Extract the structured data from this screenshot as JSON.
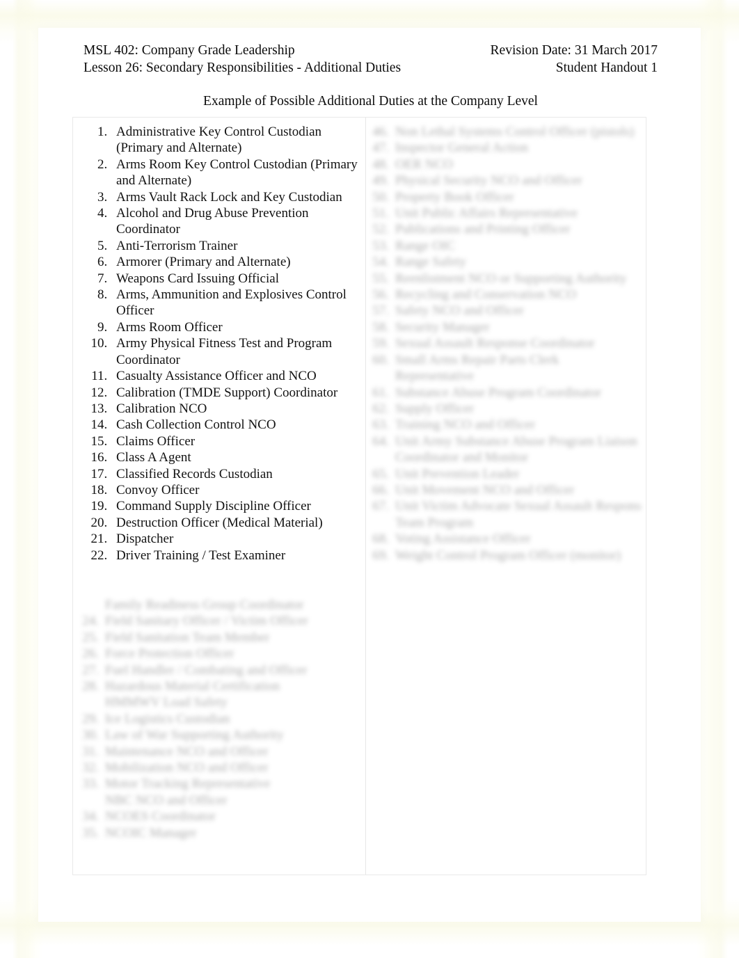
{
  "page": {
    "background_color": "#ffffff",
    "sheet_color": "#ffffff",
    "frame_tint": "#fbfbf0",
    "border_color": "#e9e9e9",
    "text_color": "#121212"
  },
  "header": {
    "course": "MSL 402: Company Grade Leadership",
    "revision": "Revision Date: 31 March 2017",
    "lesson": "Lesson 26: Secondary Responsibilities - Additional Duties",
    "handout": "Student Handout 1"
  },
  "title": "Example of Possible Additional Duties at the Company Level",
  "left_column": {
    "items": [
      "Administrative Key Control Custodian (Primary and Alternate)",
      "Arms Room Key Control Custodian (Primary and Alternate)",
      "Arms Vault Rack Lock and Key Custodian",
      "Alcohol and Drug Abuse Prevention Coordinator",
      "Anti-Terrorism Trainer",
      "Armorer (Primary and Alternate)",
      "Weapons Card Issuing Official",
      "Arms, Ammunition and Explosives Control Officer",
      "Arms Room Officer",
      "Army Physical Fitness Test and Program Coordinator",
      "Casualty Assistance Officer and NCO",
      "Calibration (TMDE Support) Coordinator",
      "Calibration NCO",
      "Cash Collection Control NCO",
      "Claims Officer",
      "Class A Agent",
      "Classified Records Custodian",
      "Convoy Officer",
      "Command Supply Discipline Officer",
      "Destruction Officer (Medical Material)",
      "Dispatcher",
      "Driver Training / Test Examiner"
    ],
    "redacted_lines": [
      {
        "number": "",
        "text": "Family Readiness Group Coordinator",
        "continuation": true
      },
      {
        "number": "24.",
        "text": "Field Sanitary Officer / Victim Officer",
        "continuation": false
      },
      {
        "number": "25.",
        "text": "Field Sanitation Team Member",
        "continuation": false
      },
      {
        "number": "26.",
        "text": "Force Protection Officer",
        "continuation": false
      },
      {
        "number": "27.",
        "text": "Fuel Handler / Combating and Officer",
        "continuation": false
      },
      {
        "number": "28.",
        "text": "Hazardous Material Certification",
        "continuation": false
      },
      {
        "number": "",
        "text": "HMMWV Load Safety",
        "continuation": true
      },
      {
        "number": "29.",
        "text": "Ice Logistics Custodian",
        "continuation": false
      },
      {
        "number": "30.",
        "text": "Law of War Supporting Authority",
        "continuation": false
      },
      {
        "number": "31.",
        "text": "Maintenance NCO and Officer",
        "continuation": false
      },
      {
        "number": "32.",
        "text": "Mobilization NCO and Officer",
        "continuation": false
      },
      {
        "number": "33.",
        "text": "Motor Tracking Representative",
        "continuation": false
      },
      {
        "number": "",
        "text": "NBC NCO and Officer",
        "continuation": true
      },
      {
        "number": "34.",
        "text": "NCOES Coordinator",
        "continuation": false
      },
      {
        "number": "35.",
        "text": "NCOIC Manager",
        "continuation": false
      }
    ]
  },
  "right_column": {
    "redacted_lines": [
      {
        "number": "46.",
        "text": "Non Lethal Systems Control Officer (pistols)",
        "continuation": false
      },
      {
        "number": "47.",
        "text": "Inspector General Action",
        "continuation": false
      },
      {
        "number": "48.",
        "text": "OER NCO",
        "continuation": false
      },
      {
        "number": "49.",
        "text": "Physical Security NCO and Officer",
        "continuation": false
      },
      {
        "number": "50.",
        "text": "Property Book Officer",
        "continuation": false
      },
      {
        "number": "51.",
        "text": "Unit Public Affairs Representative",
        "continuation": false
      },
      {
        "number": "52.",
        "text": "Publications and Printing Officer",
        "continuation": false
      },
      {
        "number": "53.",
        "text": "Range OIC",
        "continuation": false
      },
      {
        "number": "54.",
        "text": "Range Safety",
        "continuation": false
      },
      {
        "number": "55.",
        "text": "Reenlistment NCO or Supporting Authority",
        "continuation": false
      },
      {
        "number": "56.",
        "text": "Recycling and Conservation NCO",
        "continuation": false
      },
      {
        "number": "57.",
        "text": "Safety NCO and Officer",
        "continuation": false
      },
      {
        "number": "58.",
        "text": "Security Manager",
        "continuation": false
      },
      {
        "number": "59.",
        "text": "Sexual Assault Response Coordinator",
        "continuation": false
      },
      {
        "number": "60.",
        "text": "Small Arms Repair Parts Clerk",
        "continuation": false
      },
      {
        "number": "",
        "text": "Representative",
        "continuation": true
      },
      {
        "number": "61.",
        "text": "Substance Abuse Program Coordinator",
        "continuation": false
      },
      {
        "number": "62.",
        "text": "Supply Officer",
        "continuation": false
      },
      {
        "number": "63.",
        "text": "Training NCO and Officer",
        "continuation": false
      },
      {
        "number": "64.",
        "text": "Unit Army Substance Abuse Program Liaison",
        "continuation": false
      },
      {
        "number": "",
        "text": "Coordinator and Monitor",
        "continuation": true
      },
      {
        "number": "65.",
        "text": "Unit Prevention Leader",
        "continuation": false
      },
      {
        "number": "66.",
        "text": "Unit Movement NCO and Officer",
        "continuation": false
      },
      {
        "number": "67.",
        "text": "Unit Victim Advocate Sexual Assault Response",
        "continuation": false
      },
      {
        "number": "",
        "text": "Team Program",
        "continuation": true
      },
      {
        "number": "68.",
        "text": "Voting Assistance Officer",
        "continuation": false
      },
      {
        "number": "69.",
        "text": "Weight Control Program Officer (monitor)",
        "continuation": false
      }
    ]
  }
}
